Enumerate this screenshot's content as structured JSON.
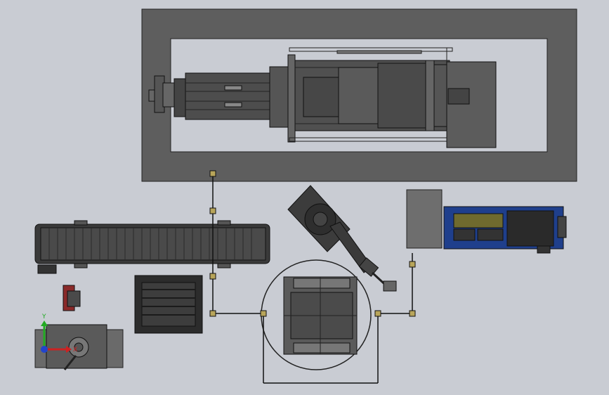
{
  "viewport": {
    "background": "#c9ccd3",
    "axis_triad": {
      "y_label": "Y",
      "x_label": "X",
      "y_color": "#22aa22",
      "x_color": "#cc2222"
    }
  },
  "components": [
    {
      "id": "machine-enclosure",
      "kind": "frame",
      "color": "#5a5a5a"
    },
    {
      "id": "injection-machine",
      "kind": "press",
      "color": "#444444"
    },
    {
      "id": "belt-conveyor",
      "kind": "conveyor",
      "color": "#333333"
    },
    {
      "id": "robot-arm",
      "kind": "robot",
      "color": "#3a3a3a"
    },
    {
      "id": "control-cabinet",
      "kind": "panel",
      "color": "#1e3f8a"
    },
    {
      "id": "electrical-box",
      "kind": "box",
      "color": "#6a6a6a"
    },
    {
      "id": "rotary-table",
      "kind": "fixture",
      "color": "#555555"
    },
    {
      "id": "part-rack",
      "kind": "rack",
      "color": "#2e2e2e"
    },
    {
      "id": "gear-unit",
      "kind": "drive",
      "color": "#666666"
    },
    {
      "id": "motor",
      "kind": "motor",
      "color": "#8a2a2a"
    }
  ],
  "fence": {
    "color": "#111111",
    "post_color": "#b8a55a"
  }
}
